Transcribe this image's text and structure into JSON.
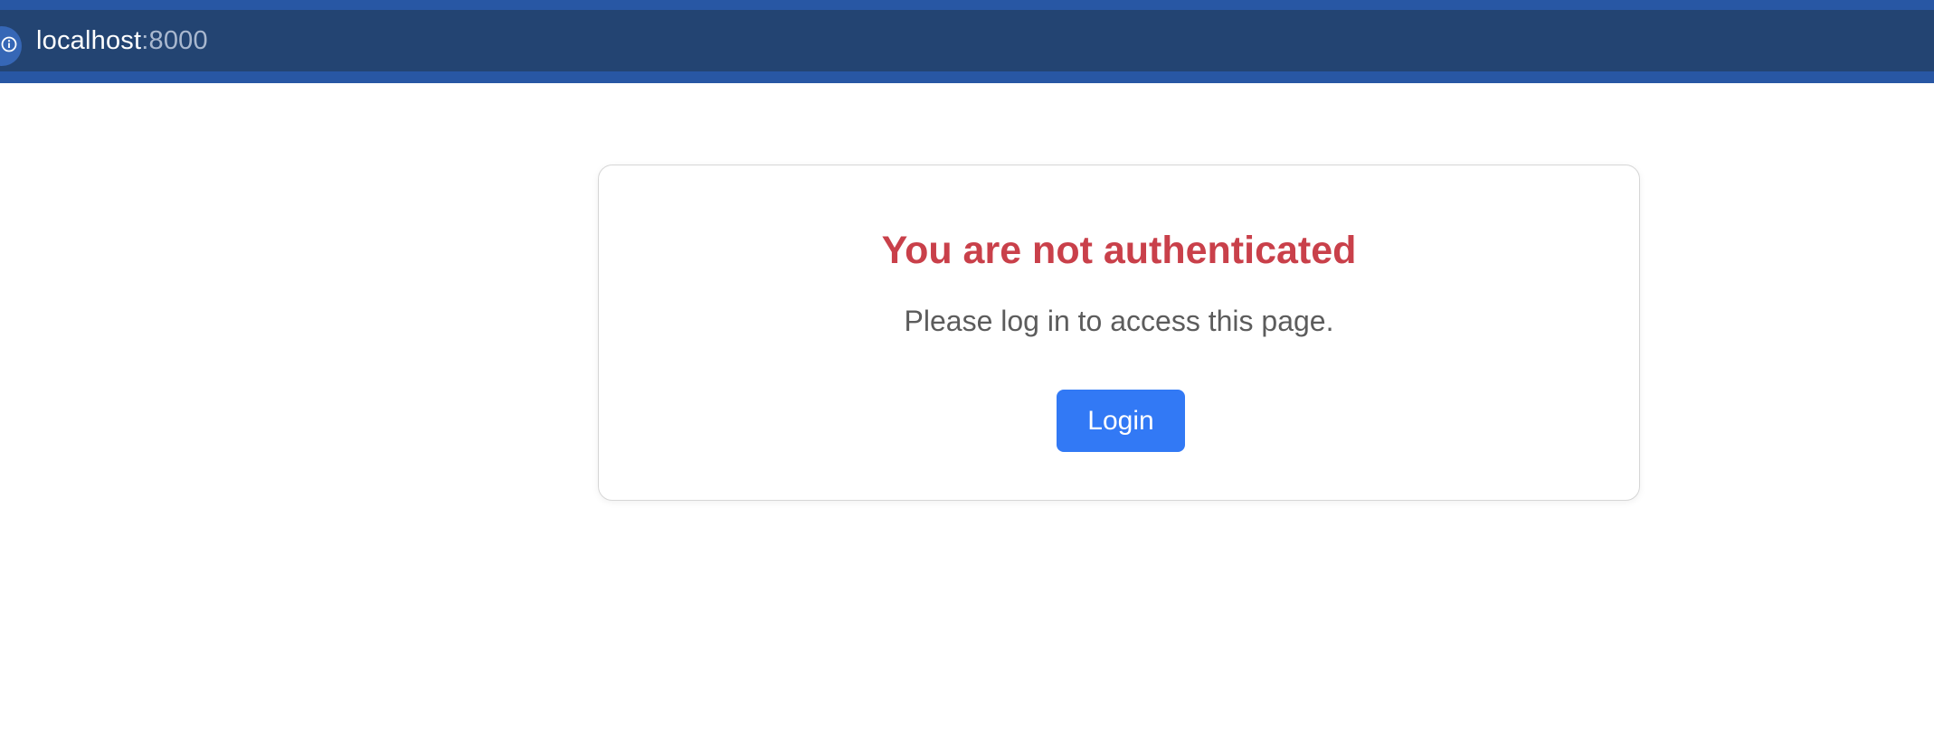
{
  "browser": {
    "url_host": "localhost",
    "url_port": ":8000",
    "icon": "info-icon"
  },
  "card": {
    "title": "You are not authenticated",
    "message": "Please log in to access this page.",
    "login_label": "Login"
  },
  "colors": {
    "browser_bar": "#2857a4",
    "address_strip": "#234472",
    "title": "#c9404a",
    "message": "#5c5c5c",
    "button": "#3279f5"
  }
}
